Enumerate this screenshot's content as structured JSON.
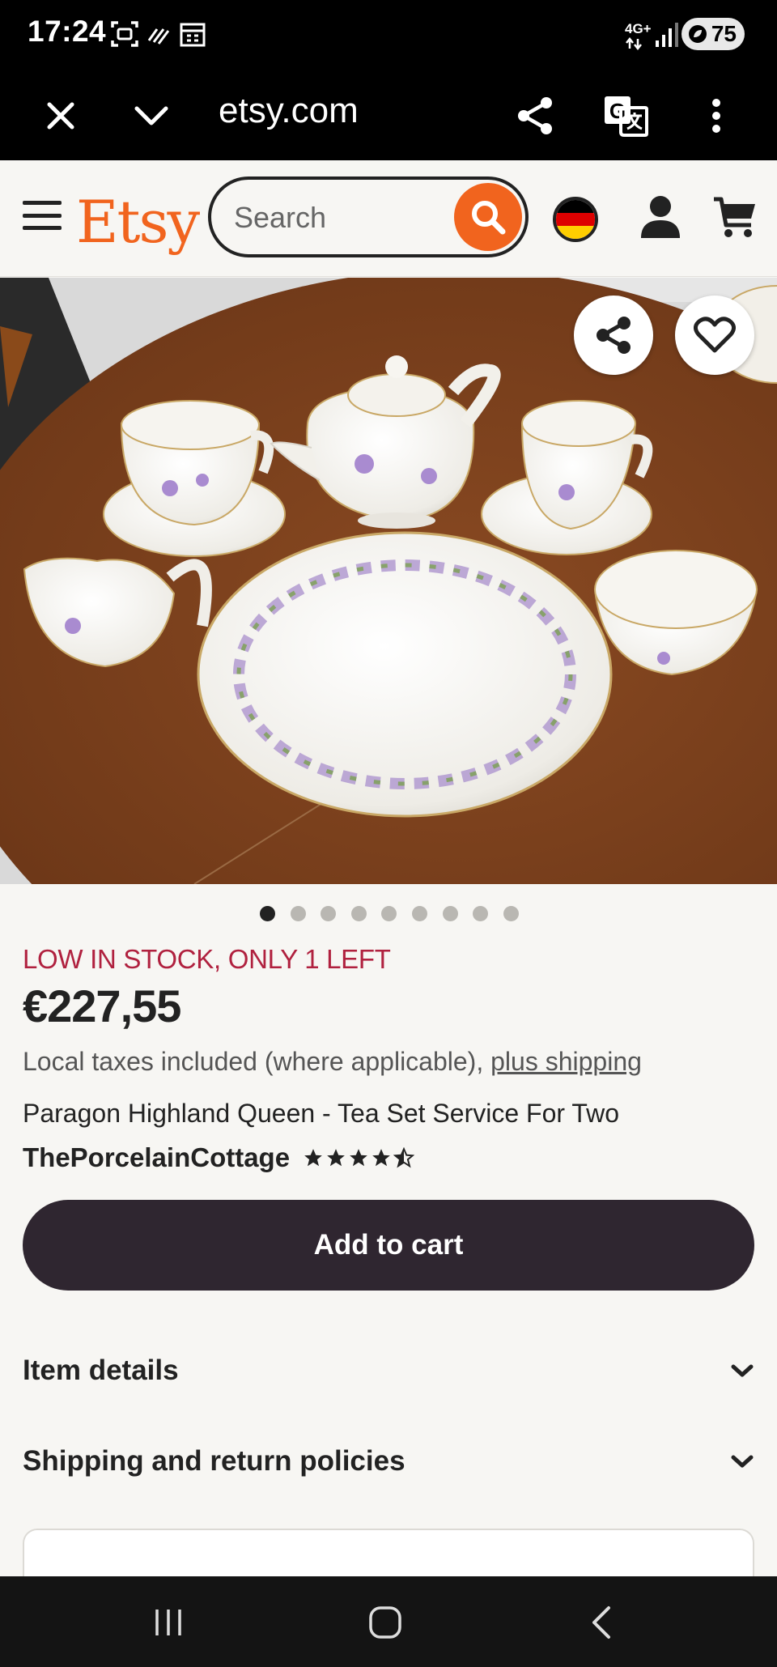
{
  "status_bar": {
    "time": "17:24",
    "network": "4G+",
    "battery": "75"
  },
  "browser": {
    "url": "etsy.com",
    "icons": [
      "close-icon",
      "chevron-down-icon",
      "share-icon",
      "translate-icon",
      "more-vert-icon"
    ]
  },
  "header": {
    "logo": "Etsy",
    "search_placeholder": "Search",
    "icons": [
      "hamburger-icon",
      "search-icon",
      "germany-flag-icon",
      "user-icon",
      "cart-icon"
    ],
    "colors": {
      "brand": "#f1641e",
      "dark": "#222222"
    }
  },
  "gallery": {
    "image_count": 9,
    "active_index": 0,
    "buttons": [
      "share-icon",
      "heart-icon"
    ]
  },
  "product": {
    "stock_notice": "LOW IN STOCK, ONLY 1 LEFT",
    "price": "€227,55",
    "taxes_text": "Local taxes included (where applicable), ",
    "shipping_link": "plus shipping",
    "title": "Paragon Highland Queen - Tea Set Service For Two",
    "shop_name": "ThePorcelainCottage",
    "rating": 4.5,
    "colors": {
      "stock": "#b0213f",
      "button": "#2f2630"
    }
  },
  "actions": {
    "add_to_cart": "Add to cart"
  },
  "sections": [
    {
      "label": "Item details"
    },
    {
      "label": "Shipping and return policies"
    }
  ],
  "nav_bar": {
    "icons": [
      "recents-icon",
      "home-icon",
      "back-icon"
    ]
  }
}
